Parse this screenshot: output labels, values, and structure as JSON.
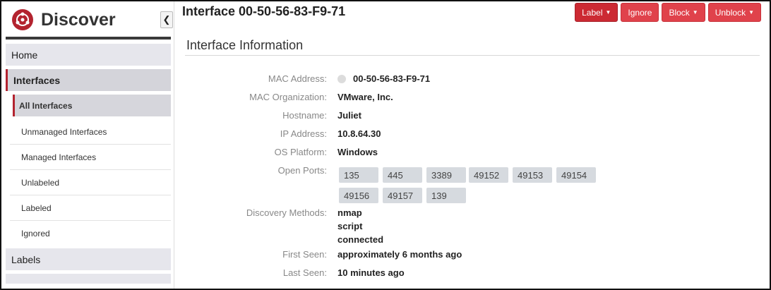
{
  "sidebar": {
    "app_title": "Discover",
    "collapse_icon": "chevron-left-icon",
    "items": [
      {
        "label": "Home"
      },
      {
        "label": "Interfaces"
      },
      {
        "label": "Labels"
      }
    ],
    "sub_items": [
      {
        "label": "All Interfaces"
      },
      {
        "label": "Unmanaged Interfaces"
      },
      {
        "label": "Managed Interfaces"
      },
      {
        "label": "Unlabeled"
      },
      {
        "label": "Labeled"
      },
      {
        "label": "Ignored"
      }
    ]
  },
  "header": {
    "title": "Interface 00-50-56-83-F9-71",
    "buttons": {
      "label": "Label",
      "ignore": "Ignore",
      "block": "Block",
      "unblock": "Unblock"
    }
  },
  "section": {
    "title": "Interface Information"
  },
  "fields": {
    "mac_address_label": "MAC Address:",
    "mac_address": "00-50-56-83-F9-71",
    "mac_org_label": "MAC Organization:",
    "mac_org": "VMware, Inc.",
    "hostname_label": "Hostname:",
    "hostname": "Juliet",
    "ip_label": "IP Address:",
    "ip": "10.8.64.30",
    "os_label": "OS Platform:",
    "os": "Windows",
    "ports_label": "Open Ports:",
    "ports": [
      "135",
      "445",
      "3389",
      "49152",
      "49153",
      "49154",
      "49156",
      "49157",
      "139"
    ],
    "discovery_label": "Discovery Methods:",
    "discovery": [
      "nmap",
      "script",
      "connected"
    ],
    "first_seen_label": "First Seen:",
    "first_seen": "approximately 6 months ago",
    "last_seen_label": "Last Seen:",
    "last_seen": "10 minutes ago"
  },
  "colors": {
    "accent": "#b3232f",
    "button": "#e0424b",
    "button_dark": "#cc2a33"
  }
}
